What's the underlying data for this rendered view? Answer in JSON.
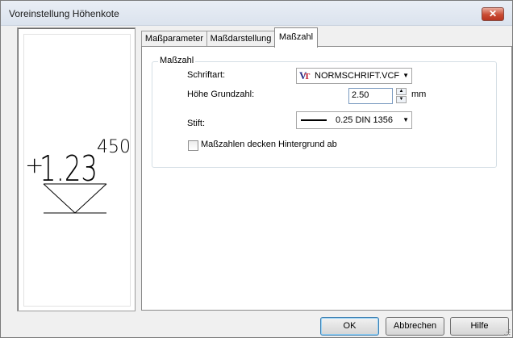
{
  "window": {
    "title": "Voreinstellung Höhenkote",
    "close_symbol": "✕"
  },
  "preview": {
    "sign": "+",
    "value": "1.23",
    "superscript": "450"
  },
  "tabs": [
    {
      "label": "Maßparameter",
      "active": false
    },
    {
      "label": "Maßdarstellung",
      "active": false
    },
    {
      "label": "Maßzahl",
      "active": true
    }
  ],
  "group": {
    "title": "Maßzahl",
    "font_label": "Schriftart:",
    "font_value": "NORMSCHRIFT.VCF",
    "height_label": "Höhe Grundzahl:",
    "height_value": "2.50",
    "height_unit": "mm",
    "pen_label": "Stift:",
    "pen_value": "0.25 DIN 1356",
    "checkbox_label": "Maßzahlen decken Hintergrund ab",
    "checkbox_checked": false
  },
  "buttons": {
    "ok": "OK",
    "cancel": "Abbrechen",
    "help": "Hilfe"
  },
  "icons": {
    "close": "close-icon",
    "dropdown": "chevron-down-icon",
    "font": "vector-font-icon",
    "spin_up": "spin-up-icon",
    "spin_down": "spin-down-icon"
  },
  "colors": {
    "close_button": "#c94b33",
    "font_icon_v": "#2b2f87",
    "font_icon_t": "#c0182c",
    "default_button_border": "#3c7fb1"
  }
}
